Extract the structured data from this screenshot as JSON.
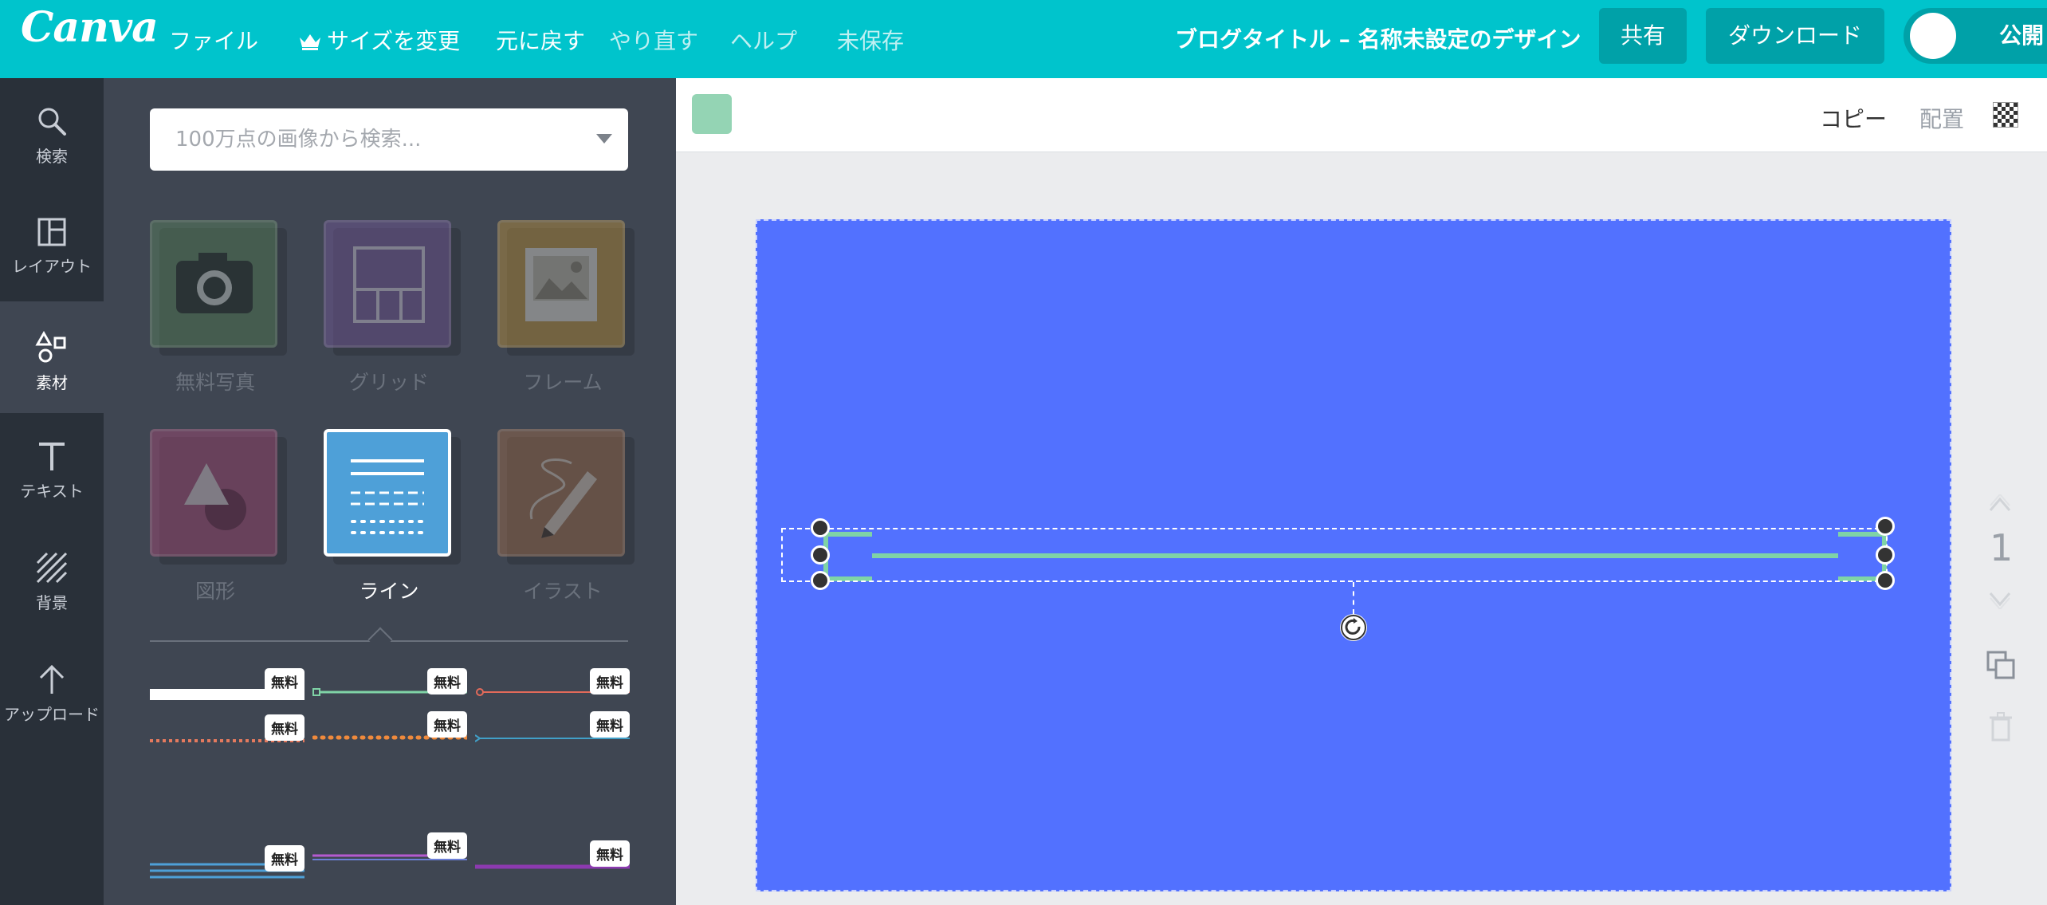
{
  "header": {
    "logo": "Canva",
    "menu": {
      "file": "ファイル",
      "resize": "サイズを変更",
      "undo": "元に戻す",
      "redo": "やり直す",
      "help": "ヘルプ",
      "unsaved": "未保存"
    },
    "doc_title": "ブログタイトル – 名称未設定のデザイン",
    "share": "共有",
    "download": "ダウンロード",
    "publish": "公開"
  },
  "rail": {
    "items": [
      {
        "label": "検索",
        "icon": "search-icon"
      },
      {
        "label": "レイアウト",
        "icon": "layout-icon"
      },
      {
        "label": "素材",
        "icon": "elements-icon",
        "active": true
      },
      {
        "label": "テキスト",
        "icon": "text-icon"
      },
      {
        "label": "背景",
        "icon": "background-icon"
      },
      {
        "label": "アップロード",
        "icon": "upload-icon"
      }
    ]
  },
  "panel": {
    "search_placeholder": "100万点の画像から検索...",
    "categories": [
      {
        "label": "無料写真",
        "color": "#5c8a5e"
      },
      {
        "label": "グリッド",
        "color": "#7a5aa2"
      },
      {
        "label": "フレーム",
        "color": "#c99a3c"
      },
      {
        "label": "図形",
        "color": "#b04a7a"
      },
      {
        "label": "ライン",
        "color": "#4ea0d8",
        "active": true
      },
      {
        "label": "イラスト",
        "color": "#a8704a"
      }
    ],
    "free_badge": "無料"
  },
  "editor": {
    "swatch_color": "#94d4b4",
    "copy": "コピー",
    "arrange": "配置",
    "page_number": "1",
    "page_color": "#5271ff",
    "line_color": "#7fd3a6"
  }
}
